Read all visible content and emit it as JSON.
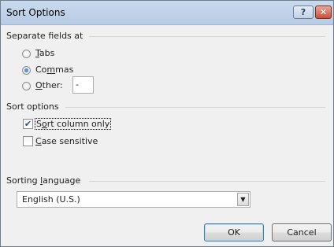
{
  "dialog": {
    "title": "Sort Options",
    "help_glyph": "?",
    "close_glyph": "✕"
  },
  "separate_fields": {
    "heading": "Separate fields at",
    "options": [
      {
        "prefix": "",
        "accel": "T",
        "suffix": "abs",
        "checked": false
      },
      {
        "prefix": "Co",
        "accel": "m",
        "suffix": "mas",
        "checked": true
      },
      {
        "prefix": "",
        "accel": "O",
        "suffix": "ther:",
        "checked": false
      }
    ],
    "other_value": "-"
  },
  "sort_options": {
    "heading": "Sort options",
    "checkboxes": [
      {
        "prefix": "S",
        "accel": "o",
        "suffix": "rt column only",
        "checked": true
      },
      {
        "prefix": "",
        "accel": "C",
        "suffix": "ase sensitive",
        "checked": false
      }
    ]
  },
  "sorting_language": {
    "heading_prefix": "Sorting ",
    "heading_accel": "l",
    "heading_suffix": "anguage",
    "selected": "English (U.S.)"
  },
  "buttons": {
    "ok": "OK",
    "cancel": "Cancel"
  },
  "icons": {
    "check": "✔",
    "dropdown_arrow": "▼"
  }
}
